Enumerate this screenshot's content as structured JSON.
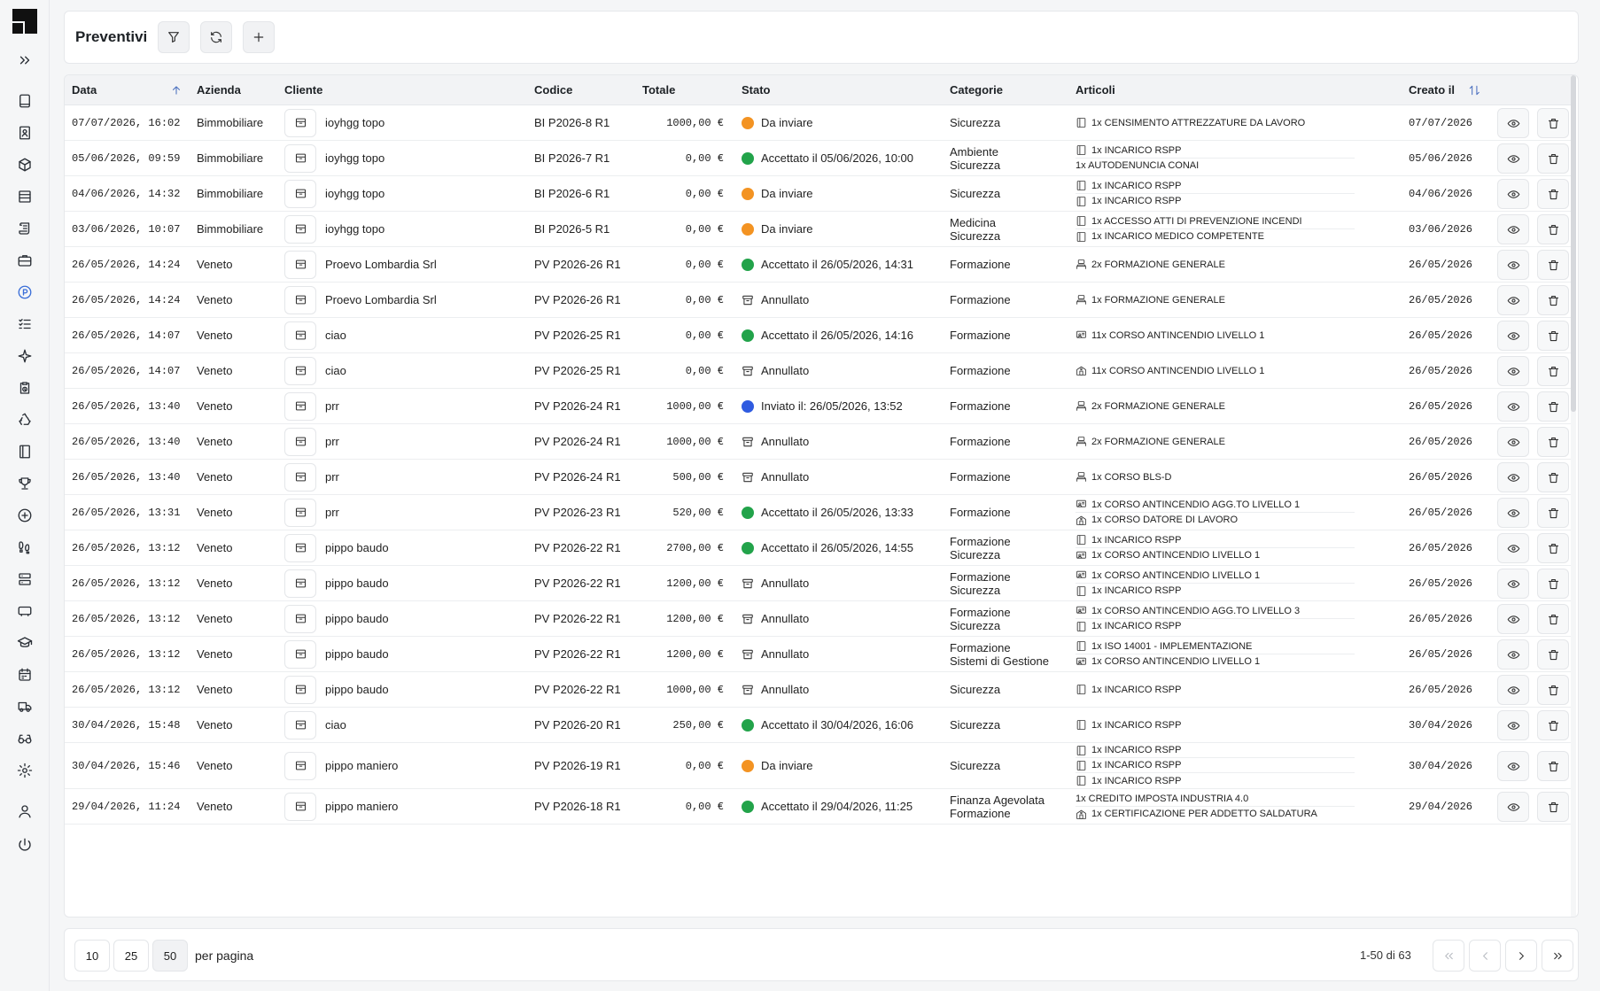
{
  "header": {
    "title": "Preventivi",
    "filter_icon": "filter-icon",
    "refresh_icon": "refresh-icon",
    "add_icon": "plus-icon"
  },
  "sidebar": {
    "items": [
      {
        "icon": "expand-icon"
      },
      {
        "icon": "book-icon"
      },
      {
        "icon": "contact-book-icon"
      },
      {
        "icon": "package-icon"
      },
      {
        "icon": "list-icon"
      },
      {
        "icon": "scroll-icon"
      },
      {
        "icon": "briefcase-icon"
      },
      {
        "icon": "preventivi-icon",
        "active": true
      },
      {
        "icon": "checklist-icon"
      },
      {
        "icon": "sparkle-icon"
      },
      {
        "icon": "clipboard-clock-icon"
      },
      {
        "icon": "recycle-icon"
      },
      {
        "icon": "binder-icon"
      },
      {
        "icon": "trophy-icon"
      },
      {
        "icon": "plus-circle-icon"
      },
      {
        "icon": "footprints-icon"
      },
      {
        "icon": "server-icon"
      },
      {
        "icon": "screen-icon"
      },
      {
        "icon": "graduation-cap-icon"
      },
      {
        "icon": "calendar-icon"
      },
      {
        "icon": "truck-icon"
      },
      {
        "icon": "glasses-icon"
      },
      {
        "icon": "settings-icon"
      },
      {
        "icon": "user-icon"
      },
      {
        "icon": "power-icon"
      }
    ]
  },
  "table": {
    "columns": {
      "data": "Data",
      "azienda": "Azienda",
      "cliente": "Cliente",
      "codice": "Codice",
      "totale": "Totale",
      "stato": "Stato",
      "categorie": "Categorie",
      "articoli": "Articoli",
      "creato": "Creato il"
    },
    "rows": [
      {
        "data": "07/07/2026, 16:02",
        "azienda": "Bimmobiliare",
        "cliente": "ioyhgg topo",
        "codice": "BI P2026-8 R1",
        "totale": "1000,00 €",
        "stato": "Da inviare",
        "stato_type": "orange",
        "categorie": [
          "Sicurezza"
        ],
        "articoli": [
          {
            "icon": "binder",
            "text": "1x CENSIMENTO ATTREZZATURE DA LAVORO"
          }
        ],
        "creato": "07/07/2026"
      },
      {
        "data": "05/06/2026, 09:59",
        "azienda": "Bimmobiliare",
        "cliente": "ioyhgg topo",
        "codice": "BI P2026-7 R1",
        "totale": "0,00 €",
        "stato": "Accettato il 05/06/2026, 10:00",
        "stato_type": "green",
        "categorie": [
          "Ambiente",
          "Sicurezza"
        ],
        "articoli": [
          {
            "icon": "binder",
            "text": "1x INCARICO RSPP"
          },
          {
            "icon": "",
            "text": "1x AUTODENUNCIA CONAI"
          }
        ],
        "creato": "05/06/2026"
      },
      {
        "data": "04/06/2026, 14:32",
        "azienda": "Bimmobiliare",
        "cliente": "ioyhgg topo",
        "codice": "BI P2026-6 R1",
        "totale": "0,00 €",
        "stato": "Da inviare",
        "stato_type": "orange",
        "categorie": [
          "Sicurezza"
        ],
        "articoli": [
          {
            "icon": "binder",
            "text": "1x INCARICO RSPP"
          },
          {
            "icon": "binder",
            "text": "1x INCARICO RSPP"
          }
        ],
        "creato": "04/06/2026"
      },
      {
        "data": "03/06/2026, 10:07",
        "azienda": "Bimmobiliare",
        "cliente": "ioyhgg topo",
        "codice": "BI P2026-5 R1",
        "totale": "0,00 €",
        "stato": "Da inviare",
        "stato_type": "orange",
        "categorie": [
          "Medicina",
          "Sicurezza"
        ],
        "articoli": [
          {
            "icon": "binder",
            "text": "1x ACCESSO ATTI DI PREVENZIONE INCENDI"
          },
          {
            "icon": "binder",
            "text": "1x INCARICO MEDICO COMPETENTE"
          }
        ],
        "creato": "03/06/2026"
      },
      {
        "data": "26/05/2026, 14:24",
        "azienda": "Veneto",
        "cliente": "Proevo Lombardia Srl",
        "codice": "PV P2026-26 R1",
        "totale": "0,00 €",
        "stato": "Accettato il 26/05/2026, 14:31",
        "stato_type": "green",
        "categorie": [
          "Formazione"
        ],
        "articoli": [
          {
            "icon": "class",
            "text": "2x FORMAZIONE GENERALE"
          }
        ],
        "creato": "26/05/2026"
      },
      {
        "data": "26/05/2026, 14:24",
        "azienda": "Veneto",
        "cliente": "Proevo Lombardia Srl",
        "codice": "PV P2026-26 R1",
        "totale": "0,00 €",
        "stato": "Annullato",
        "stato_type": "archive",
        "categorie": [
          "Formazione"
        ],
        "articoli": [
          {
            "icon": "class",
            "text": "1x FORMAZIONE GENERALE"
          }
        ],
        "creato": "26/05/2026"
      },
      {
        "data": "26/05/2026, 14:07",
        "azienda": "Veneto",
        "cliente": "ciao",
        "codice": "PV P2026-25 R1",
        "totale": "0,00 €",
        "stato": "Accettato il 26/05/2026, 14:16",
        "stato_type": "green",
        "categorie": [
          "Formazione"
        ],
        "articoli": [
          {
            "icon": "teacher",
            "text": "11x CORSO ANTINCENDIO LIVELLO 1"
          }
        ],
        "creato": "26/05/2026"
      },
      {
        "data": "26/05/2026, 14:07",
        "azienda": "Veneto",
        "cliente": "ciao",
        "codice": "PV P2026-25 R1",
        "totale": "0,00 €",
        "stato": "Annullato",
        "stato_type": "archive",
        "categorie": [
          "Formazione"
        ],
        "articoli": [
          {
            "icon": "building",
            "text": "11x CORSO ANTINCENDIO LIVELLO 1"
          }
        ],
        "creato": "26/05/2026"
      },
      {
        "data": "26/05/2026, 13:40",
        "azienda": "Veneto",
        "cliente": "prr",
        "codice": "PV P2026-24 R1",
        "totale": "1000,00 €",
        "stato": "Inviato il: 26/05/2026, 13:52",
        "stato_type": "blue",
        "categorie": [
          "Formazione"
        ],
        "articoli": [
          {
            "icon": "class",
            "text": "2x FORMAZIONE GENERALE"
          }
        ],
        "creato": "26/05/2026"
      },
      {
        "data": "26/05/2026, 13:40",
        "azienda": "Veneto",
        "cliente": "prr",
        "codice": "PV P2026-24 R1",
        "totale": "1000,00 €",
        "stato": "Annullato",
        "stato_type": "archive",
        "categorie": [
          "Formazione"
        ],
        "articoli": [
          {
            "icon": "class",
            "text": "2x FORMAZIONE GENERALE"
          }
        ],
        "creato": "26/05/2026"
      },
      {
        "data": "26/05/2026, 13:40",
        "azienda": "Veneto",
        "cliente": "prr",
        "codice": "PV P2026-24 R1",
        "totale": "500,00 €",
        "stato": "Annullato",
        "stato_type": "archive",
        "categorie": [
          "Formazione"
        ],
        "articoli": [
          {
            "icon": "class",
            "text": "1x CORSO BLS-D"
          }
        ],
        "creato": "26/05/2026"
      },
      {
        "data": "26/05/2026, 13:31",
        "azienda": "Veneto",
        "cliente": "prr",
        "codice": "PV P2026-23 R1",
        "totale": "520,00 €",
        "stato": "Accettato il 26/05/2026, 13:33",
        "stato_type": "green",
        "categorie": [
          "Formazione"
        ],
        "articoli": [
          {
            "icon": "teacher",
            "text": "1x CORSO ANTINCENDIO AGG.TO LIVELLO 1"
          },
          {
            "icon": "building",
            "text": "1x CORSO DATORE DI LAVORO"
          }
        ],
        "creato": "26/05/2026"
      },
      {
        "data": "26/05/2026, 13:12",
        "azienda": "Veneto",
        "cliente": "pippo baudo",
        "codice": "PV P2026-22 R1",
        "totale": "2700,00 €",
        "stato": "Accettato il 26/05/2026, 14:55",
        "stato_type": "green",
        "categorie": [
          "Formazione",
          "Sicurezza"
        ],
        "articoli": [
          {
            "icon": "binder",
            "text": "1x INCARICO RSPP"
          },
          {
            "icon": "teacher",
            "text": "1x CORSO ANTINCENDIO LIVELLO 1"
          }
        ],
        "creato": "26/05/2026"
      },
      {
        "data": "26/05/2026, 13:12",
        "azienda": "Veneto",
        "cliente": "pippo baudo",
        "codice": "PV P2026-22 R1",
        "totale": "1200,00 €",
        "stato": "Annullato",
        "stato_type": "archive",
        "categorie": [
          "Formazione",
          "Sicurezza"
        ],
        "articoli": [
          {
            "icon": "teacher",
            "text": "1x CORSO ANTINCENDIO LIVELLO 1"
          },
          {
            "icon": "binder",
            "text": "1x INCARICO RSPP"
          }
        ],
        "creato": "26/05/2026"
      },
      {
        "data": "26/05/2026, 13:12",
        "azienda": "Veneto",
        "cliente": "pippo baudo",
        "codice": "PV P2026-22 R1",
        "totale": "1200,00 €",
        "stato": "Annullato",
        "stato_type": "archive",
        "categorie": [
          "Formazione",
          "Sicurezza"
        ],
        "articoli": [
          {
            "icon": "teacher",
            "text": "1x CORSO ANTINCENDIO AGG.TO LIVELLO 3"
          },
          {
            "icon": "binder",
            "text": "1x INCARICO RSPP"
          }
        ],
        "creato": "26/05/2026"
      },
      {
        "data": "26/05/2026, 13:12",
        "azienda": "Veneto",
        "cliente": "pippo baudo",
        "codice": "PV P2026-22 R1",
        "totale": "1200,00 €",
        "stato": "Annullato",
        "stato_type": "archive",
        "categorie": [
          "Formazione",
          "Sistemi di Gestione"
        ],
        "articoli": [
          {
            "icon": "binder",
            "text": "1x ISO 14001 - IMPLEMENTAZIONE"
          },
          {
            "icon": "teacher",
            "text": "1x CORSO ANTINCENDIO LIVELLO 1"
          }
        ],
        "creato": "26/05/2026"
      },
      {
        "data": "26/05/2026, 13:12",
        "azienda": "Veneto",
        "cliente": "pippo baudo",
        "codice": "PV P2026-22 R1",
        "totale": "1000,00 €",
        "stato": "Annullato",
        "stato_type": "archive",
        "categorie": [
          "Sicurezza"
        ],
        "articoli": [
          {
            "icon": "binder",
            "text": "1x INCARICO RSPP"
          }
        ],
        "creato": "26/05/2026"
      },
      {
        "data": "30/04/2026, 15:48",
        "azienda": "Veneto",
        "cliente": "ciao",
        "codice": "PV P2026-20 R1",
        "totale": "250,00 €",
        "stato": "Accettato il 30/04/2026, 16:06",
        "stato_type": "green",
        "categorie": [
          "Sicurezza"
        ],
        "articoli": [
          {
            "icon": "binder",
            "text": "1x INCARICO RSPP"
          }
        ],
        "creato": "30/04/2026"
      },
      {
        "data": "30/04/2026, 15:46",
        "azienda": "Veneto",
        "cliente": "pippo maniero",
        "codice": "PV P2026-19 R1",
        "totale": "0,00 €",
        "stato": "Da inviare",
        "stato_type": "orange",
        "categorie": [
          "Sicurezza"
        ],
        "articoli": [
          {
            "icon": "binder",
            "text": "1x INCARICO RSPP"
          },
          {
            "icon": "binder",
            "text": "1x INCARICO RSPP"
          },
          {
            "icon": "binder",
            "text": "1x INCARICO RSPP"
          }
        ],
        "creato": "30/04/2026"
      },
      {
        "data": "29/04/2026, 11:24",
        "azienda": "Veneto",
        "cliente": "pippo maniero",
        "codice": "PV P2026-18 R1",
        "totale": "0,00 €",
        "stato": "Accettato il 29/04/2026, 11:25",
        "stato_type": "green",
        "categorie": [
          "Finanza Agevolata",
          "Formazione"
        ],
        "articoli": [
          {
            "icon": "",
            "text": "1x CREDITO IMPOSTA INDUSTRIA 4.0"
          },
          {
            "icon": "building",
            "text": "1x CERTIFICAZIONE PER ADDETTO SALDATURA"
          }
        ],
        "creato": "29/04/2026"
      }
    ]
  },
  "footer": {
    "page_sizes": [
      "10",
      "25",
      "50"
    ],
    "active_page_size": "50",
    "per_page_label": "per pagina",
    "range": "1-50 di 63"
  },
  "colors": {
    "orange": "#f39322",
    "green": "#22a34a",
    "blue": "#2f5be0",
    "accent": "#3b6fd8"
  }
}
